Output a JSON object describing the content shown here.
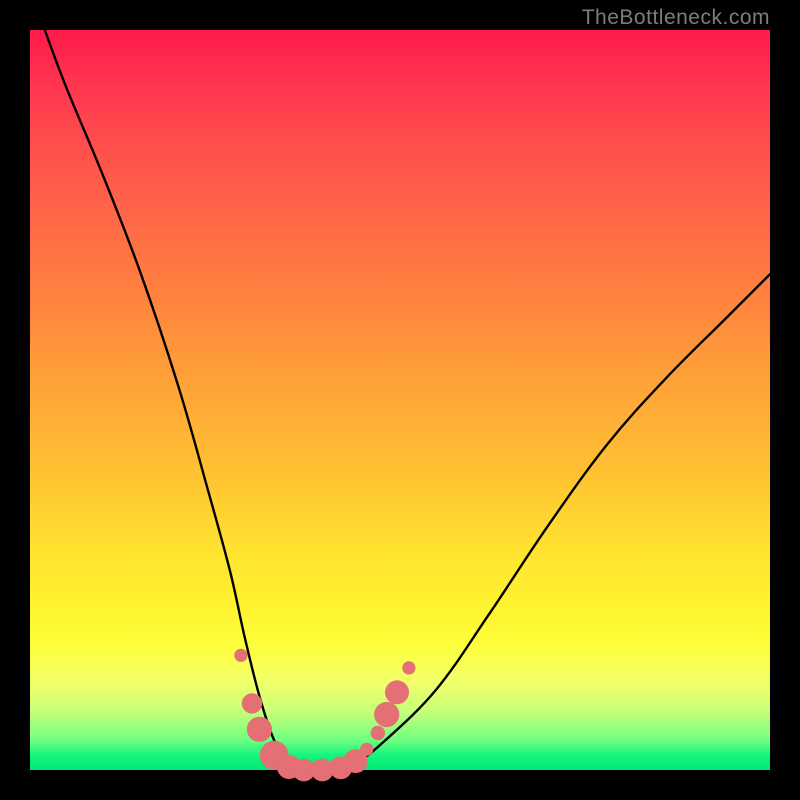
{
  "watermark": "TheBottleneck.com",
  "chart_data": {
    "type": "line",
    "title": "",
    "xlabel": "",
    "ylabel": "",
    "xlim": [
      0,
      100
    ],
    "ylim": [
      0,
      100
    ],
    "series": [
      {
        "name": "bottleneck-curve",
        "x": [
          2,
          5,
          10,
          15,
          20,
          24,
          27,
          29,
          31,
          33,
          35,
          37,
          40,
          44,
          48,
          55,
          62,
          70,
          78,
          86,
          94,
          100
        ],
        "values": [
          100,
          92,
          80,
          67,
          52,
          38,
          27,
          18,
          10,
          4,
          1,
          0,
          0,
          1,
          4,
          11,
          21,
          33,
          44,
          53,
          61,
          67
        ]
      }
    ],
    "markers": {
      "name": "highlighted-points",
      "color": "#e46f74",
      "points": [
        {
          "x": 28.5,
          "y": 15.5,
          "r": 1.1
        },
        {
          "x": 30.0,
          "y": 9.0,
          "r": 1.7
        },
        {
          "x": 31.0,
          "y": 5.5,
          "r": 2.1
        },
        {
          "x": 33.0,
          "y": 2.0,
          "r": 2.4
        },
        {
          "x": 35.0,
          "y": 0.4,
          "r": 2.0
        },
        {
          "x": 37.0,
          "y": 0.0,
          "r": 1.9
        },
        {
          "x": 39.5,
          "y": 0.0,
          "r": 1.9
        },
        {
          "x": 42.0,
          "y": 0.3,
          "r": 1.9
        },
        {
          "x": 44.0,
          "y": 1.2,
          "r": 2.0
        },
        {
          "x": 45.5,
          "y": 2.8,
          "r": 1.1
        },
        {
          "x": 47.0,
          "y": 5.0,
          "r": 1.2
        },
        {
          "x": 48.2,
          "y": 7.5,
          "r": 2.1
        },
        {
          "x": 49.6,
          "y": 10.5,
          "r": 2.0
        },
        {
          "x": 51.2,
          "y": 13.8,
          "r": 1.1
        }
      ]
    },
    "highlight_bands": [
      {
        "y_center": 11,
        "height": 4,
        "color": "#f8ffcd"
      },
      {
        "y_center": 7,
        "height": 3,
        "color": "#d7ff9b"
      }
    ]
  }
}
